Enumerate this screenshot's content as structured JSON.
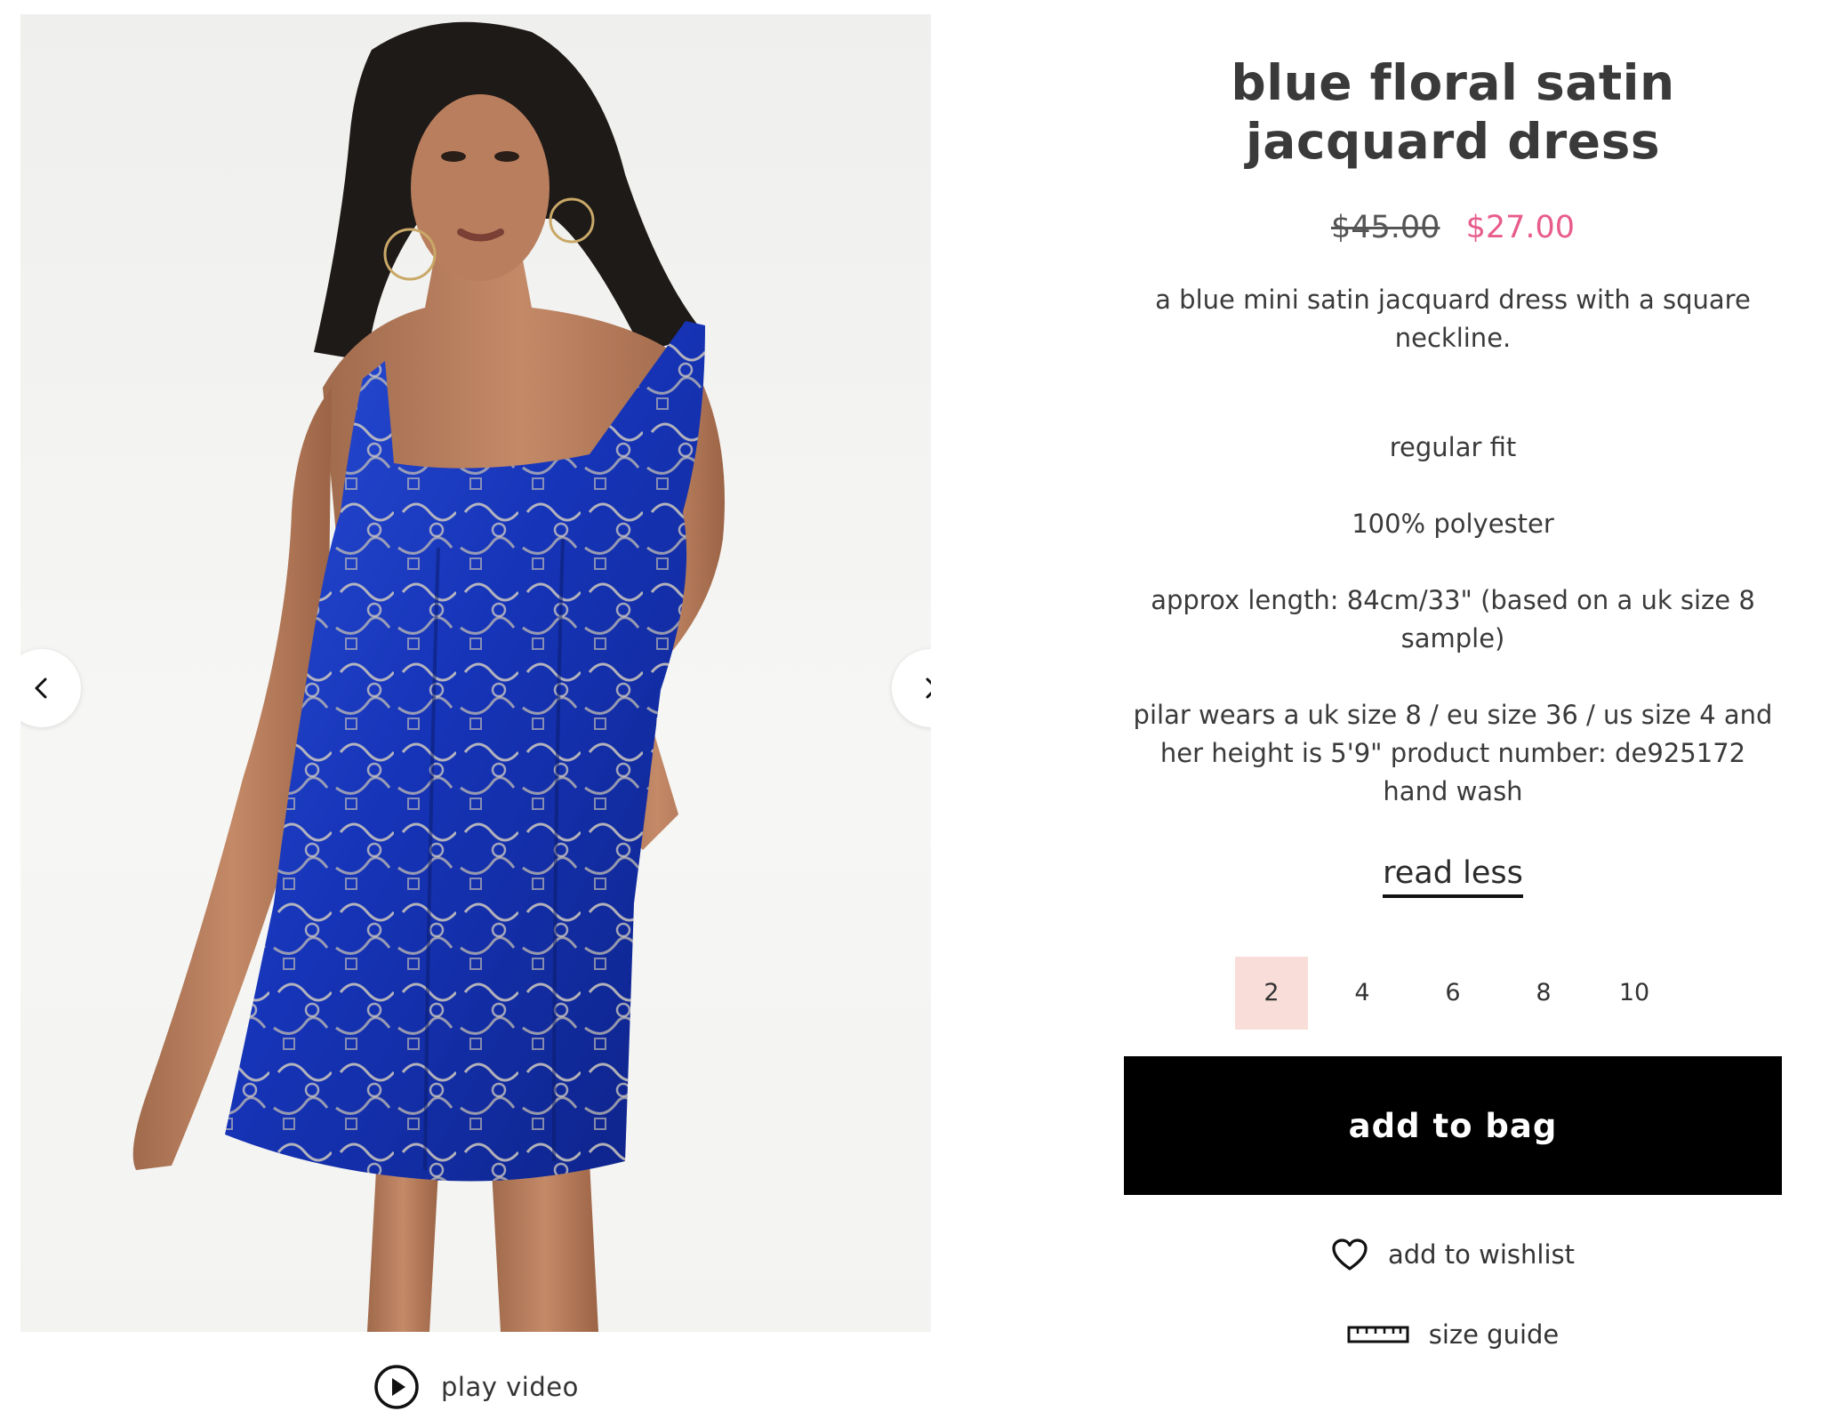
{
  "product": {
    "title": "blue floral satin jacquard dress",
    "price_original": "$45.00",
    "price_sale": "$27.00",
    "description": "a blue mini satin jacquard dress with a square neckline.",
    "specs": [
      "regular fit",
      "100% polyester",
      "approx length: 84cm/33\" (based on a uk size 8 sample)",
      "pilar wears a uk size 8 / eu size 36 / us size 4 and her height is 5'9\" product number: de925172 hand wash"
    ],
    "read_less_label": "read less"
  },
  "sizes": {
    "options": [
      "2",
      "4",
      "6",
      "8",
      "10"
    ],
    "selected": "2"
  },
  "actions": {
    "add_to_bag": "add to bag",
    "add_to_wishlist": "add to wishlist",
    "size_guide": "size guide",
    "play_video": "play video"
  },
  "colors": {
    "sale_price": "#e85c8c",
    "selected_size_bg": "#f8ddd8",
    "button_bg": "#000000",
    "dress_blue": "#1f3fbf"
  },
  "icons": {
    "gallery_prev": "chevron-left-icon",
    "gallery_next": "chevron-right-icon",
    "play": "play-circle-icon",
    "wishlist": "heart-icon",
    "size_guide": "ruler-icon"
  }
}
